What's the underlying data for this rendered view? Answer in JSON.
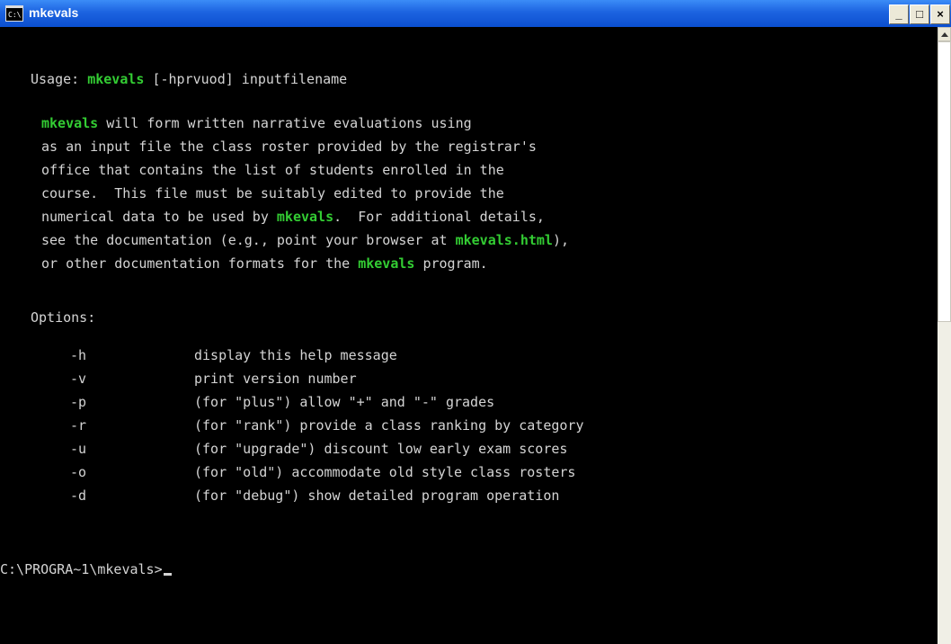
{
  "window": {
    "title": "mkevals",
    "minimize": "_",
    "maximize": "□",
    "close": "×"
  },
  "console": {
    "usage": {
      "prefix": "Usage: ",
      "cmd": "mkevals",
      "rest": " [-hprvuod] inputfilename"
    },
    "description": [
      [
        {
          "t": "mkevals",
          "hl": true
        },
        {
          "t": " will form written narrative evaluations using"
        }
      ],
      [
        {
          "t": "as an input file the class roster provided by the registrar's"
        }
      ],
      [
        {
          "t": "office that contains the list of students enrolled in the"
        }
      ],
      [
        {
          "t": "course.  This file must be suitably edited to provide the"
        }
      ],
      [
        {
          "t": "numerical data to be used by "
        },
        {
          "t": "mkevals",
          "hl": true
        },
        {
          "t": ".  For additional details,"
        }
      ],
      [
        {
          "t": "see the documentation (e.g., point your browser at "
        },
        {
          "t": "mkevals.html",
          "hl": true
        },
        {
          "t": "),"
        }
      ],
      [
        {
          "t": "or other documentation formats for the "
        },
        {
          "t": "mkevals",
          "hl": true
        },
        {
          "t": " program."
        }
      ]
    ],
    "options_heading": "Options:",
    "options": [
      {
        "flag": "-h",
        "desc": "display this help message"
      },
      {
        "flag": "-v",
        "desc": "print version number"
      },
      {
        "flag": "-p",
        "desc": "(for \"plus\") allow \"+\" and \"-\" grades"
      },
      {
        "flag": "-r",
        "desc": "(for \"rank\") provide a class ranking by category"
      },
      {
        "flag": "-u",
        "desc": "(for \"upgrade\") discount low early exam scores"
      },
      {
        "flag": "-o",
        "desc": "(for \"old\") accommodate old style class rosters"
      },
      {
        "flag": "-d",
        "desc": "(for \"debug\") show detailed program operation"
      }
    ],
    "prompt": "C:\\PROGRA~1\\mkevals>"
  },
  "colors": {
    "highlight": "#33cc33",
    "text": "#d4d4d4",
    "background": "#000000",
    "titlebar": "#0b4fd0"
  },
  "icons": {
    "app": "console-app-icon",
    "scroll_up": "scroll-up-arrow-icon"
  }
}
